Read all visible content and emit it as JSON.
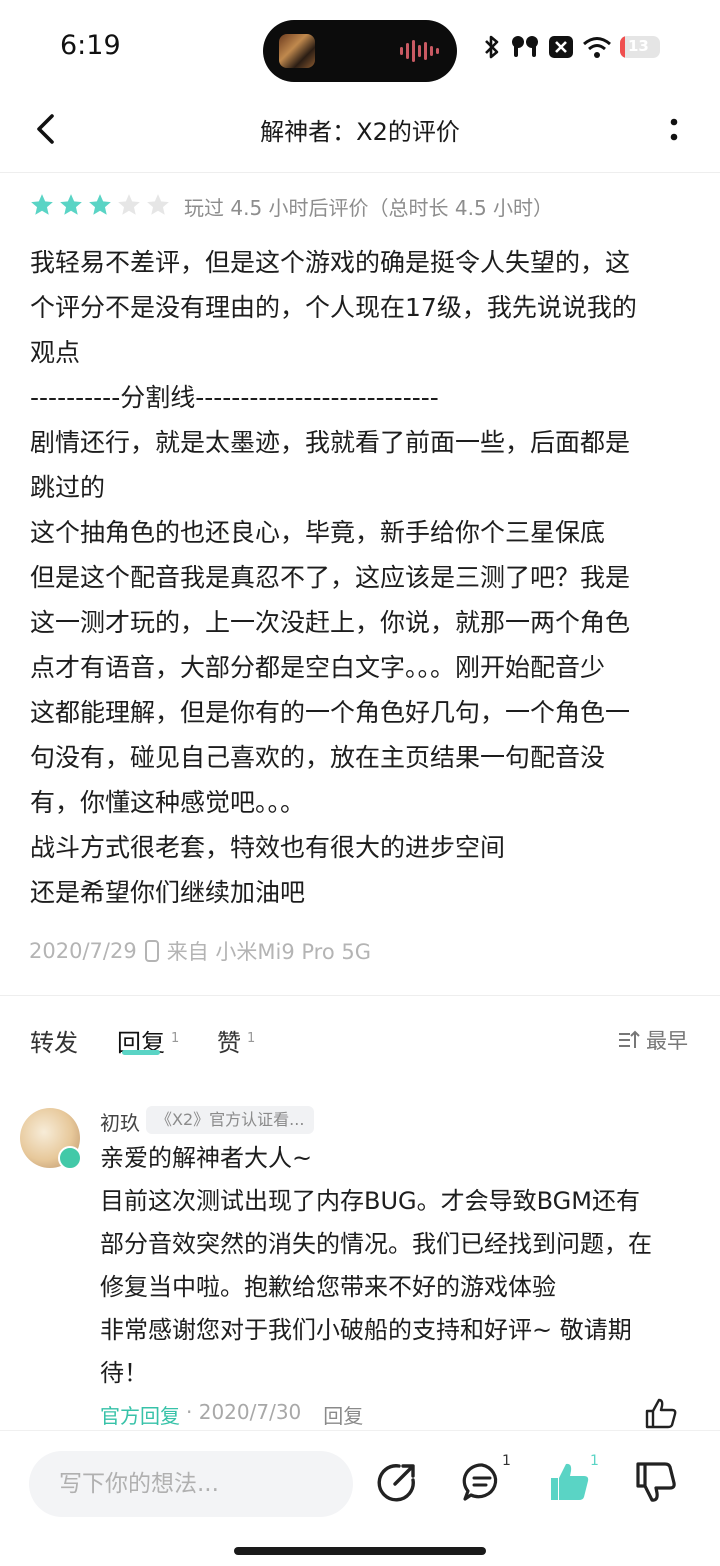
{
  "status_bar": {
    "time": "6:19",
    "battery": "13"
  },
  "header": {
    "title": "解神者：X2的评价"
  },
  "review": {
    "stars_filled": 3,
    "stars_total": 5,
    "star_color": "#5ad4c5",
    "play_meta": "玩过 4.5 小时后评价（总时长 4.5 小时）",
    "lines": [
      "我轻易不差评，但是这个游戏的确是挺令人失望的，这",
      "个评分不是没有理由的，个人现在17级，我先说说我的",
      "观点",
      "----------分割线---------------------------",
      "剧情还行，就是太墨迹，我就看了前面一些，后面都是",
      "跳过的",
      "这个抽角色的也还良心，毕竟，新手给你个三星保底",
      "但是这个配音我是真忍不了，这应该是三测了吧？我是",
      "这一测才玩的，上一次没赶上，你说，就那一两个角色",
      "点才有语音，大部分都是空白文字。。。刚开始配音少",
      "这都能理解，但是你有的一个角色好几句，一个角色一",
      "句没有，碰见自己喜欢的，放在主页结果一句配音没",
      "有，你懂这种感觉吧。。。",
      "战斗方式很老套，特效也有很大的进步空间",
      "还是希望你们继续加油吧"
    ],
    "date": "2020/7/29",
    "device": "来自 小米Mi9 Pro 5G"
  },
  "tabs": {
    "forward": "转发",
    "reply": "回复",
    "reply_count": "1",
    "like": "赞",
    "like_count": "1",
    "sort": "最早"
  },
  "reply": {
    "name": "初玖",
    "badge": "《X2》官方认证看...",
    "lines": [
      "亲爱的解神者大人~",
      "目前这次测试出现了内存BUG。才会导致BGM还有",
      "部分音效突然的消失的情况。我们已经找到问题，在",
      "修复当中啦。抱歉给您带来不好的游戏体验",
      "非常感谢您对于我们小破船的支持和好评~ 敬请期",
      "待！"
    ],
    "official_label": "官方回复",
    "date": "· 2020/7/30",
    "reply_action": "回复"
  },
  "bottom_bar": {
    "placeholder": "写下你的想法...",
    "comment_count": "1",
    "like_count": "1",
    "accent": "#5ad4c5"
  }
}
